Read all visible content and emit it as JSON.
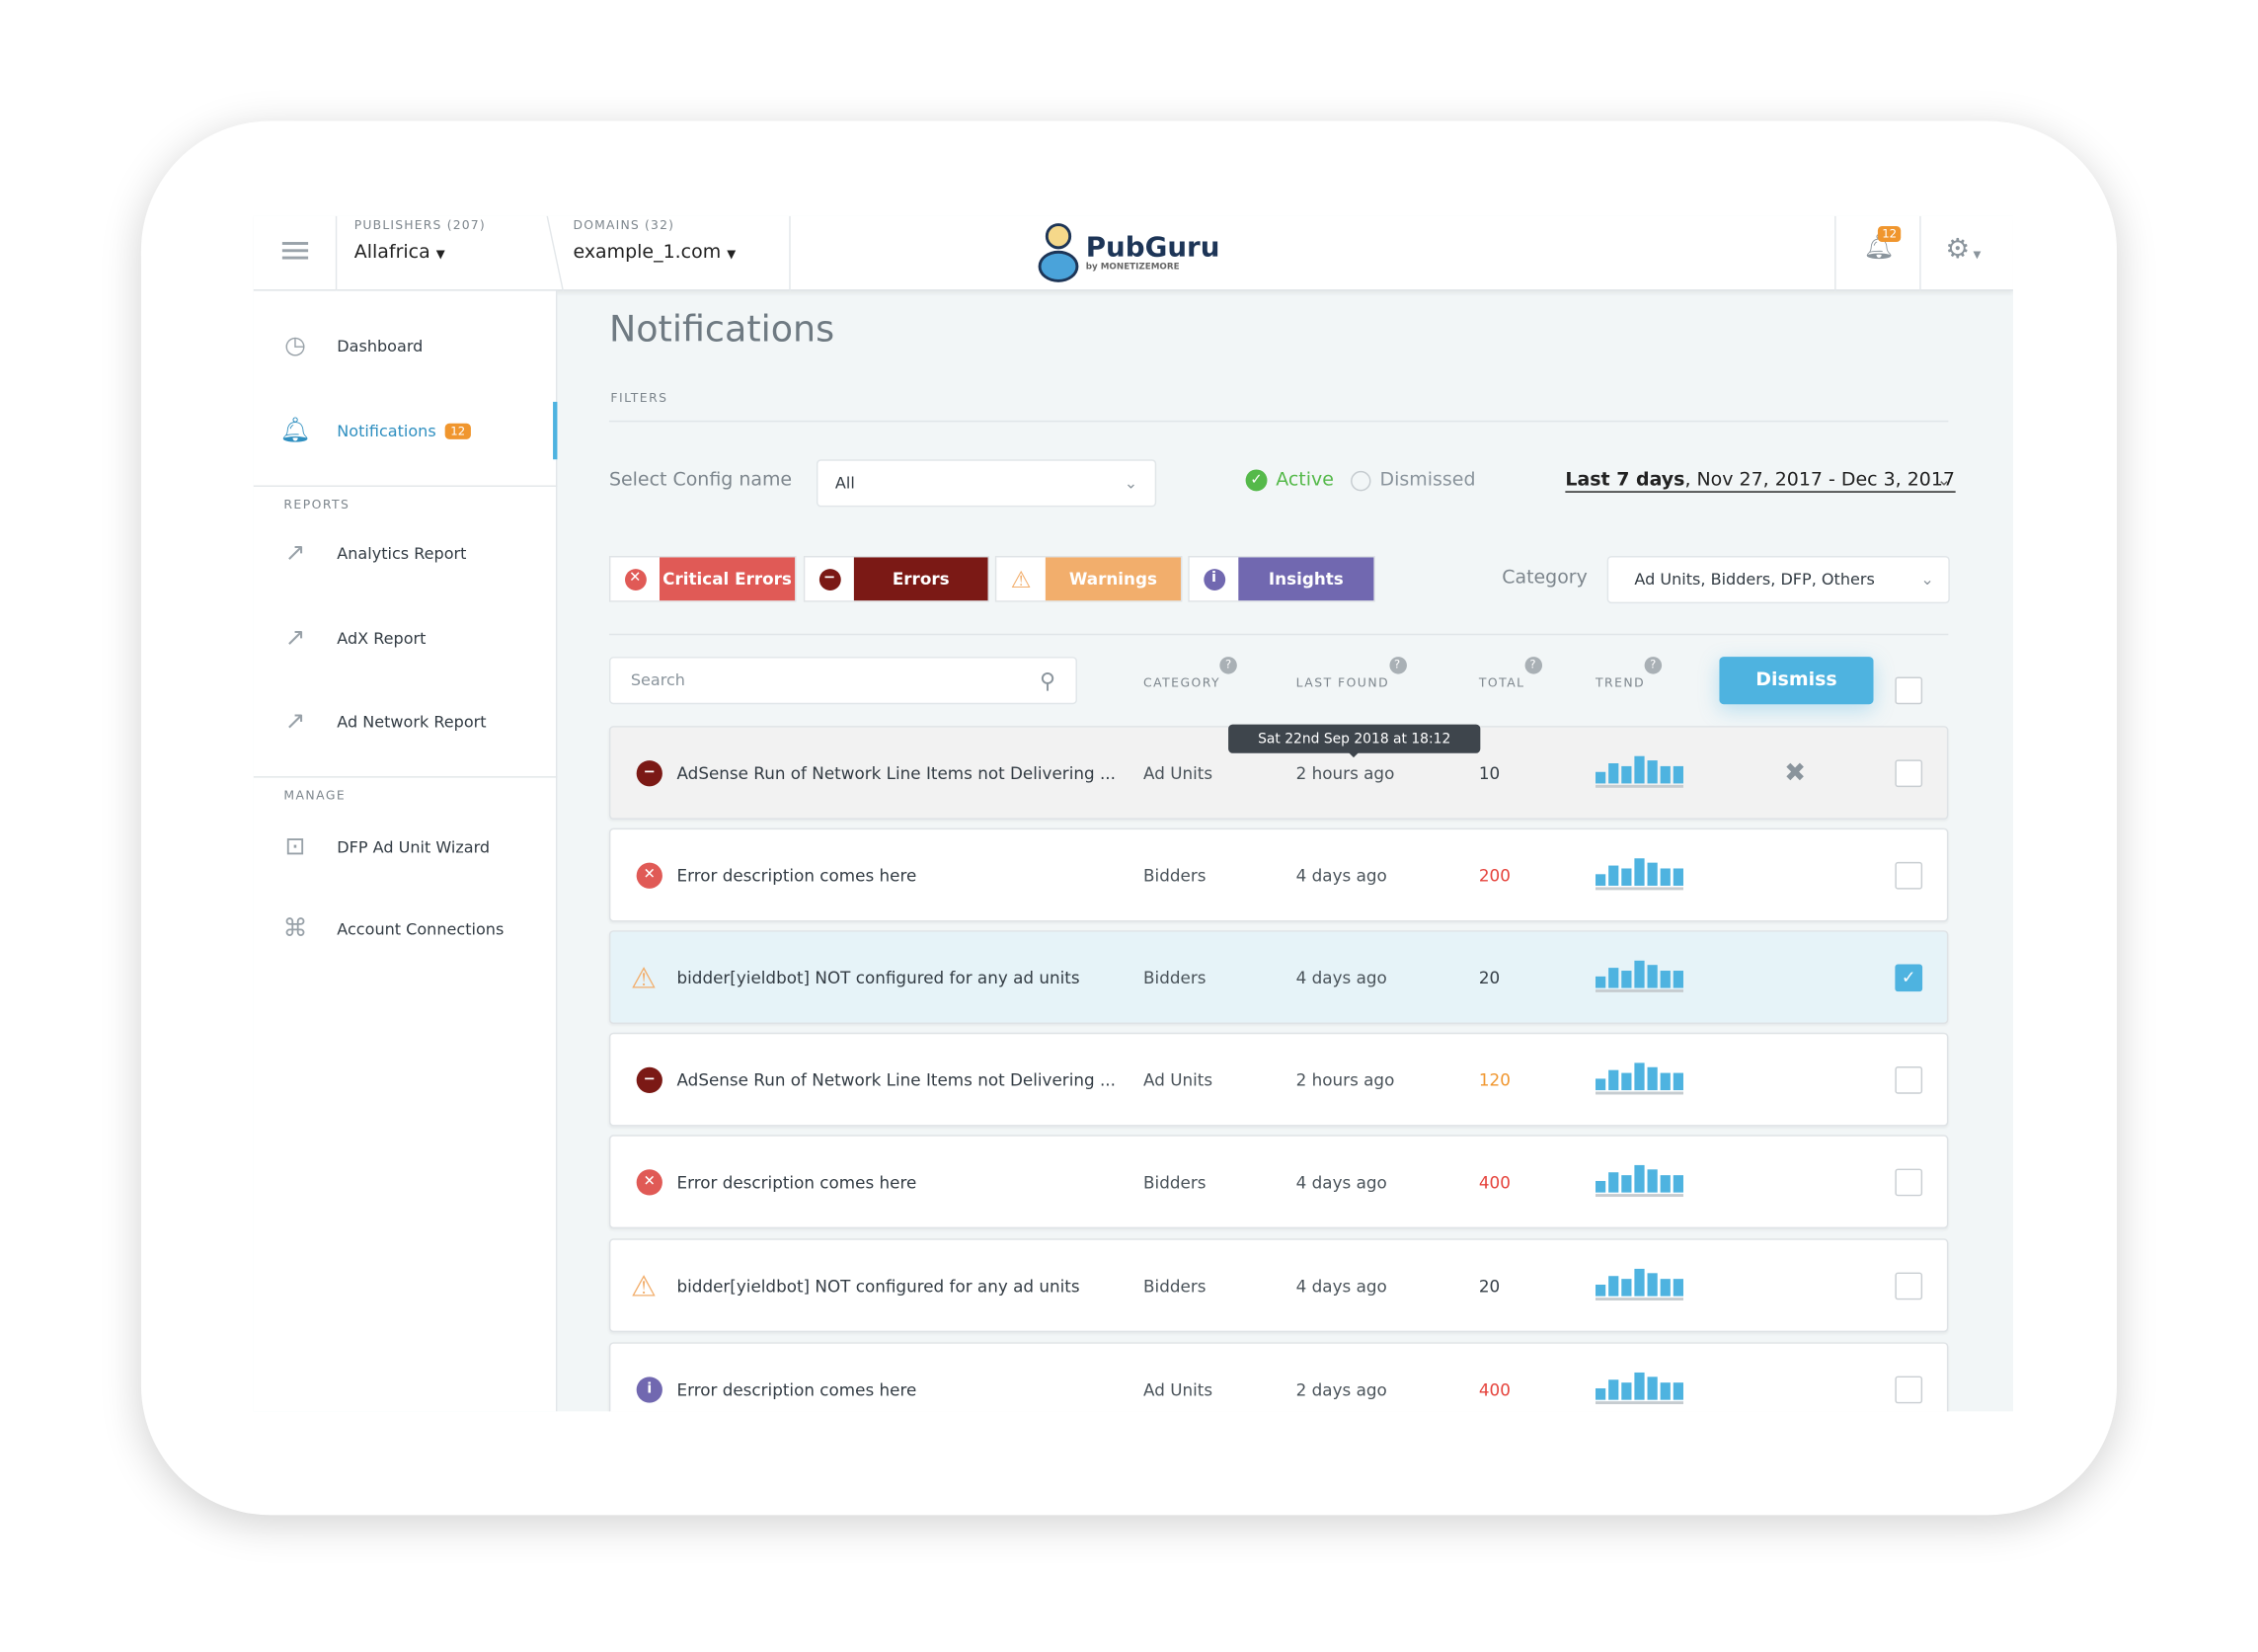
{
  "header": {
    "publishers_label": "PUBLISHERS (207)",
    "publisher": "Allafrica",
    "domains_label": "DOMAINS (32)",
    "domain": "example_1.com",
    "logo_name": "PubGuru",
    "logo_sub": "by MONETIZEMORE",
    "notif_count": "12"
  },
  "sidebar": {
    "dashboard": "Dashboard",
    "notifications": "Notifications",
    "notifications_badge": "12",
    "reports_section": "REPORTS",
    "analytics": "Analytics Report",
    "adx": "AdX Report",
    "adnetwork": "Ad Network Report",
    "manage_section": "MANAGE",
    "dfp": "DFP Ad Unit Wizard",
    "connections": "Account Connections"
  },
  "main": {
    "title": "Notifications",
    "filters_label": "FILTERS",
    "config_label": "Select Config name",
    "config_value": "All",
    "status_active": "Active",
    "status_dismissed": "Dismissed",
    "date_bold": "Last 7 days",
    "date_range": ", Nov 27, 2017 - Dec 3, 2017",
    "chips": {
      "critical": "Critical Errors",
      "errors": "Errors",
      "warnings": "Warnings",
      "insights": "Insights"
    },
    "category_label": "Category",
    "category_value": "Ad Units,  Bidders,  DFP,  Others",
    "search_placeholder": "Search",
    "col_category": "CATEGORY",
    "col_last_found": "LAST FOUND",
    "col_total": "TOTAL",
    "col_trend": "TREND",
    "dismiss": "Dismiss",
    "tooltip": "Sat 22nd Sep 2018 at 18:12",
    "colors": {
      "critical": "#e05a56",
      "error": "#7b1915",
      "warning": "#f2ae6c",
      "insight": "#7168b0",
      "accent": "#4eb3e0",
      "active": "#55b94a"
    },
    "rows": [
      {
        "type": "error",
        "message": "AdSense Run of Network Line Items not Delivering ...",
        "category": "Ad Units",
        "last_found": "2 hours ago",
        "total": "10",
        "total_color": "#333c44",
        "trend": [
          4,
          7,
          6,
          10,
          8,
          6,
          6
        ],
        "checked": false
      },
      {
        "type": "critical",
        "message": "Error description comes here",
        "category": "Bidders",
        "last_found": "4 days ago",
        "total": "200",
        "total_color": "#e5423b",
        "trend": [
          4,
          7,
          6,
          10,
          8,
          6,
          6
        ],
        "checked": false
      },
      {
        "type": "warning",
        "message": "bidder[yieldbot] NOT configured for any ad units",
        "category": "Bidders",
        "last_found": "4 days ago",
        "total": "20",
        "total_color": "#333c44",
        "trend": [
          4,
          7,
          6,
          10,
          8,
          6,
          6
        ],
        "checked": true
      },
      {
        "type": "error",
        "message": "AdSense Run of Network Line Items not Delivering ...",
        "category": "Ad Units",
        "last_found": "2 hours ago",
        "total": "120",
        "total_color": "#f0962e",
        "trend": [
          4,
          7,
          6,
          10,
          8,
          6,
          6
        ],
        "checked": false
      },
      {
        "type": "critical",
        "message": "Error description comes here",
        "category": "Bidders",
        "last_found": "4 days ago",
        "total": "400",
        "total_color": "#e5423b",
        "trend": [
          4,
          7,
          6,
          10,
          8,
          6,
          6
        ],
        "checked": false
      },
      {
        "type": "warning",
        "message": "bidder[yieldbot] NOT configured for any ad units",
        "category": "Bidders",
        "last_found": "4 days ago",
        "total": "20",
        "total_color": "#333c44",
        "trend": [
          4,
          7,
          6,
          10,
          8,
          6,
          6
        ],
        "checked": false
      },
      {
        "type": "insight",
        "message": "Error description comes here",
        "category": "Ad Units",
        "last_found": "2 days ago",
        "total": "400",
        "total_color": "#e5423b",
        "trend": [
          4,
          7,
          6,
          10,
          8,
          6,
          6
        ],
        "checked": false
      }
    ]
  }
}
